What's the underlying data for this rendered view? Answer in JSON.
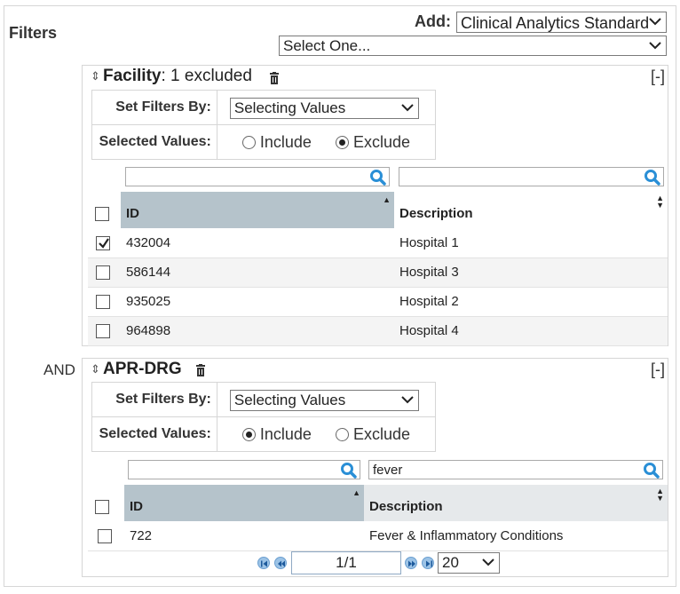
{
  "header": {
    "title": "Filters",
    "add_label": "Add:",
    "add_select_value": "Clinical Analytics Standard",
    "select_one_value": "Select One..."
  },
  "facility": {
    "title": "Facility",
    "summary": ": 1 excluded",
    "collapse_label": "[-]",
    "set_filters_by_label": "Set Filters By:",
    "set_filters_by_value": "Selecting Values",
    "selected_values_label": "Selected Values:",
    "include_label": "Include",
    "exclude_label": "Exclude",
    "mode": "exclude",
    "id_search_value": "",
    "desc_search_value": "",
    "columns": {
      "id": "ID",
      "description": "Description"
    },
    "rows": [
      {
        "id": "432004",
        "description": "Hospital 1",
        "checked": true
      },
      {
        "id": "586144",
        "description": "Hospital 3",
        "checked": false
      },
      {
        "id": "935025",
        "description": "Hospital 2",
        "checked": false
      },
      {
        "id": "964898",
        "description": "Hospital 4",
        "checked": false
      }
    ]
  },
  "connector": "AND",
  "apr_drg": {
    "title": "APR-DRG",
    "collapse_label": "[-]",
    "set_filters_by_label": "Set Filters By:",
    "set_filters_by_value": "Selecting Values",
    "selected_values_label": "Selected Values:",
    "include_label": "Include",
    "exclude_label": "Exclude",
    "mode": "include",
    "id_search_value": "",
    "desc_search_value": "fever",
    "columns": {
      "id": "ID",
      "description": "Description"
    },
    "rows": [
      {
        "id": "722",
        "description": "Fever & Inflammatory Conditions",
        "checked": false
      }
    ],
    "pager": {
      "page": "1/1",
      "page_size": "20"
    }
  },
  "icons": {
    "search": "search-icon",
    "trash": "trash-icon",
    "sort": "sort-arrows-icon",
    "chevron": "chevron-down-icon",
    "pager_first": "first-page-icon",
    "pager_prev": "prev-page-icon",
    "pager_next": "next-page-icon",
    "pager_last": "last-page-icon"
  },
  "colors": {
    "accent": "#2a8fd6",
    "sorted_header": "#b5c3cb",
    "unsorted_header": "#e6e9eb"
  }
}
